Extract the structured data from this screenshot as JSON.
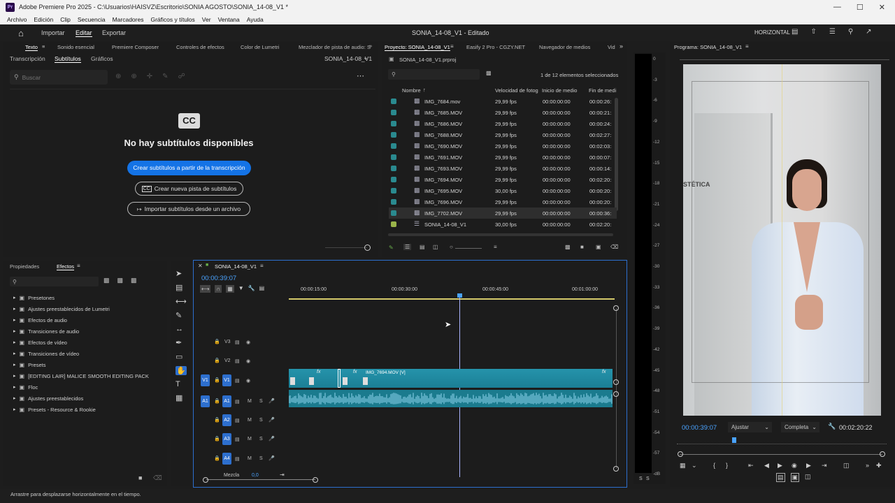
{
  "titlebar": {
    "title": "Adobe Premiere Pro 2025 - C:\\Usuarios\\HAISVZ\\Escritorio\\SONIA AGOSTO\\SONIA_14-08_V1 *"
  },
  "menu": [
    "Archivo",
    "Edición",
    "Clip",
    "Secuencia",
    "Marcadores",
    "Gráficos y títulos",
    "Ver",
    "Ventana",
    "Ayuda"
  ],
  "workbar": {
    "import": "Importar",
    "edit": "Editar",
    "export": "Exportar",
    "project_title": "SONIA_14-08_V1 - Editado",
    "layout": "HORIZONTAL"
  },
  "top_left_tabs": [
    "Texto",
    "Sonido esencial",
    "Premiere Composer",
    "Controles de efectos",
    "Color de Lumetri",
    "Mezclador de pista de audio: S"
  ],
  "text_panel": {
    "subtabs": [
      "Transcripción",
      "Subtítulos",
      "Gráficos"
    ],
    "sequence": "SONIA_14-08_V1",
    "search_placeholder": "Buscar",
    "cc_badge": "CC",
    "no_subs": "No hay subtítulos disponibles",
    "btn_create_from_transcript": "Crear subtítulos a partir de la transcripción",
    "btn_new_track": "Crear nueva pista de subtítulos",
    "btn_import": "Importar subtítulos desde un archivo"
  },
  "project": {
    "tabs": [
      "Proyecto: SONIA_14-08_V1",
      "Easify 2 Pro - CGZY.NET",
      "Navegador de medios",
      "Vid"
    ],
    "file": "SONIA_14-08_V1.prproj",
    "selection": "1 de 12 elementos seleccionados",
    "columns": [
      "Nombre",
      "Velocidad de fotog",
      "Inicio de medio",
      "Fin de medi"
    ],
    "rows": [
      {
        "name": "IMG_7684.mov",
        "fps": "29,99 fps",
        "start": "00:00:00:00",
        "end": "00:00:26:"
      },
      {
        "name": "IMG_7685.MOV",
        "fps": "29,99 fps",
        "start": "00:00:00:00",
        "end": "00:00:21:"
      },
      {
        "name": "IMG_7686.MOV",
        "fps": "29,99 fps",
        "start": "00:00:00:00",
        "end": "00:00:24:"
      },
      {
        "name": "IMG_7688.MOV",
        "fps": "29,99 fps",
        "start": "00:00:00:00",
        "end": "00:02:27:"
      },
      {
        "name": "IMG_7690.MOV",
        "fps": "29,99 fps",
        "start": "00:00:00:00",
        "end": "00:02:03:"
      },
      {
        "name": "IMG_7691.MOV",
        "fps": "29,99 fps",
        "start": "00:00:00:00",
        "end": "00:00:07:"
      },
      {
        "name": "IMG_7693.MOV",
        "fps": "29,99 fps",
        "start": "00:00:00:00",
        "end": "00:00:14:"
      },
      {
        "name": "IMG_7694.MOV",
        "fps": "29,99 fps",
        "start": "00:00:00:00",
        "end": "00:02:20:"
      },
      {
        "name": "IMG_7695.MOV",
        "fps": "30,00 fps",
        "start": "00:00:00:00",
        "end": "00:00:20:"
      },
      {
        "name": "IMG_7696.MOV",
        "fps": "29,99 fps",
        "start": "00:00:00:00",
        "end": "00:00:20:"
      },
      {
        "name": "IMG_7702.MOV",
        "fps": "29,99 fps",
        "start": "00:00:00:00",
        "end": "00:00:36:"
      },
      {
        "name": "SONIA_14-08_V1",
        "fps": "30,00 fps",
        "start": "00:00:00:00",
        "end": "00:02:20:"
      }
    ]
  },
  "program": {
    "title": "Programa: SONIA_14-08_V1",
    "timecode": "00:00:39:07",
    "fit": "Ajustar",
    "quality": "Completa",
    "duration": "00:02:20:22",
    "watermark_text": "STÉTICA"
  },
  "meter": {
    "ticks": [
      "0",
      "-3",
      "-6",
      "-9",
      "-12",
      "-15",
      "-18",
      "-21",
      "-24",
      "-27",
      "-30",
      "-33",
      "-36",
      "-39",
      "-42",
      "-45",
      "-48",
      "-51",
      "-54",
      "-57",
      "-dB"
    ],
    "solo": [
      "S",
      "S"
    ]
  },
  "effects": {
    "tabs": [
      "Propiedades",
      "Efectos"
    ],
    "items": [
      "Presetones",
      "Ajustes preestablecidos de Lumetri",
      "Efectos de audio",
      "Transiciones de audio",
      "Efectos de vídeo",
      "Transiciones de vídeo",
      "Presets",
      "[EDITING LAIR] MALICE SMOOTH EDITING PACK",
      "Floc",
      "Ajustes preestablecidos",
      "Presets - Resource & Rookie"
    ]
  },
  "timeline": {
    "tab": "SONIA_14-08_V1",
    "timecode": "00:00:39:07",
    "ruler": [
      "00:00:15:00",
      "00:00:30:00",
      "00:00:45:00",
      "00:01:00:00"
    ],
    "video_tracks": [
      "V3",
      "V2",
      "V1"
    ],
    "audio_tracks": [
      "A1",
      "A2",
      "A3",
      "A4"
    ],
    "mix": "Mezcla",
    "mix_val": "0,0",
    "clip_label": "IMG_7694.MOV [V]"
  },
  "status": "Arrastre para desplazarse horizontalmente en el tiempo."
}
